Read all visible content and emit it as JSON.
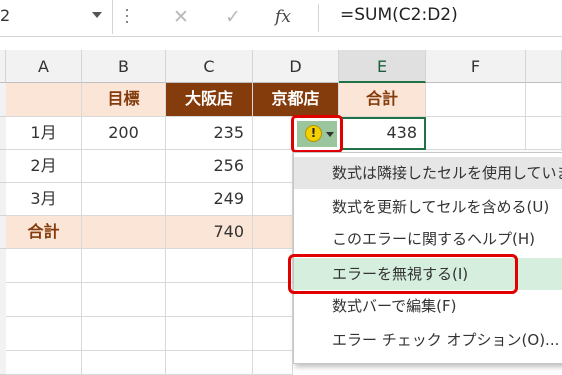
{
  "formula_bar": {
    "name_box": "2",
    "cancel_icon": "✕",
    "enter_icon": "✓",
    "fx_label": "fx",
    "formula": "=SUM(C2:D2)"
  },
  "columns": [
    "A",
    "B",
    "C",
    "D",
    "E",
    "F"
  ],
  "selected_column": "E",
  "rows": [
    {
      "a": "",
      "b": "目標",
      "c": "大阪店",
      "d": "京都店",
      "e": "合計"
    },
    {
      "a": "1月",
      "b": "200",
      "c": "235",
      "d": "",
      "e": "438"
    },
    {
      "a": "2月",
      "b": "",
      "c": "256",
      "d": "",
      "e": ""
    },
    {
      "a": "3月",
      "b": "",
      "c": "249",
      "d": "",
      "e": ""
    },
    {
      "a": "合計",
      "b": "",
      "c": "740",
      "d": "",
      "e": ""
    }
  ],
  "smart_tag": {
    "icon": "warning-icon",
    "icon_glyph": "!",
    "highlight_color": "#e00000"
  },
  "error_menu": {
    "items": [
      {
        "label": "数式は隣接したセルを使用していま"
      },
      {
        "label": "数式を更新してセルを含める(U)"
      },
      {
        "label": "このエラーに関するヘルプ(H)"
      },
      {
        "label": "エラーを無視する(I)"
      },
      {
        "label": "数式バーで編集(F)"
      },
      {
        "label": "エラー チェック オプション(O)..."
      }
    ],
    "highlighted_item": "エラーを無視する(I)"
  },
  "colors": {
    "header_brown": "#843c0c",
    "header_peach": "#fbe5d6",
    "excel_green": "#217346"
  }
}
